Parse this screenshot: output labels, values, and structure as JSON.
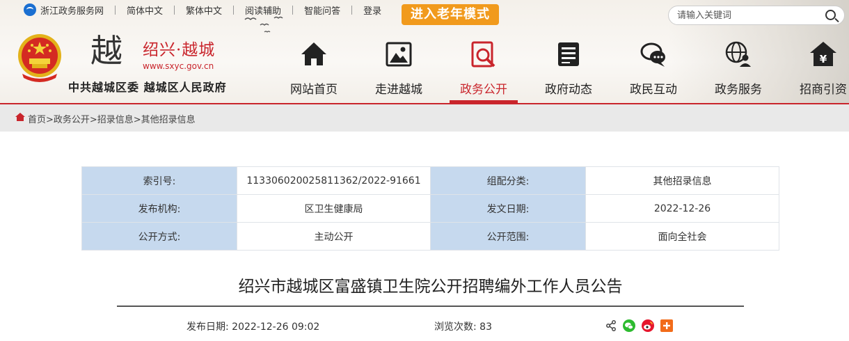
{
  "topbar": {
    "portal": "浙江政务服务网",
    "links": [
      "简体中文",
      "繁体中文",
      "阅读辅助",
      "智能问答",
      "登录"
    ],
    "elder_mode": "进入老年模式"
  },
  "search": {
    "placeholder": "请输入关键词"
  },
  "brand": {
    "calligraphy": "越",
    "site_name": "绍兴·越城",
    "url": "www.sxyc.gov.cn",
    "gov_name": "中共越城区委 越城区人民政府"
  },
  "nav": [
    {
      "label": "网站首页",
      "icon": "home-icon"
    },
    {
      "label": "走进越城",
      "icon": "picture-icon"
    },
    {
      "label": "政务公开",
      "icon": "search-doc-icon",
      "active": true
    },
    {
      "label": "政府动态",
      "icon": "news-icon"
    },
    {
      "label": "政民互动",
      "icon": "chat-icon"
    },
    {
      "label": "政务服务",
      "icon": "globe-user-icon"
    },
    {
      "label": "招商引资",
      "icon": "yuan-house-icon"
    }
  ],
  "breadcrumb": "首页>政务公开>招录信息>其他招录信息",
  "meta": {
    "rows": [
      [
        "索引号:",
        "113306020025811362/2022-91661",
        "组配分类:",
        "其他招录信息"
      ],
      [
        "发布机构:",
        "区卫生健康局",
        "发文日期:",
        "2022-12-26"
      ],
      [
        "公开方式:",
        "主动公开",
        "公开范围:",
        "面向全社会"
      ]
    ]
  },
  "article": {
    "title": "绍兴市越城区富盛镇卫生院公开招聘编外工作人员公告",
    "publish_label": "发布日期:",
    "publish_date": "2022-12-26 09:02",
    "views_label": "浏览次数:",
    "views": "83"
  },
  "colors": {
    "accent": "#c9252c",
    "elder": "#f19a1c",
    "meta_key_bg": "#c6d9ee"
  }
}
